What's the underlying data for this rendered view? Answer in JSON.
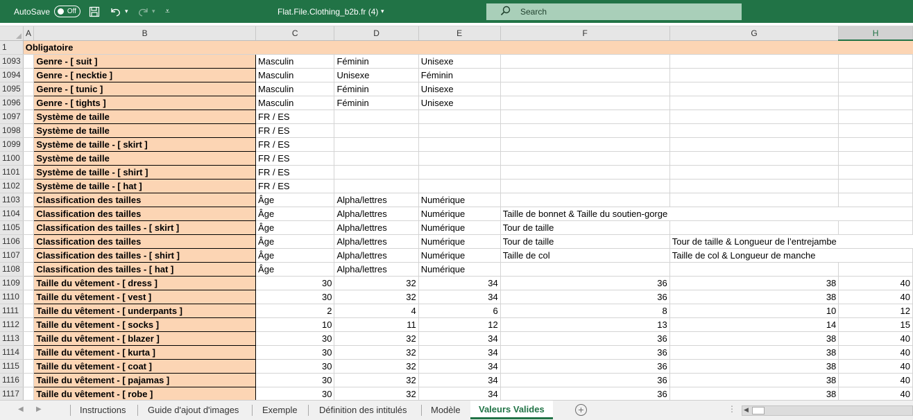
{
  "titlebar": {
    "autosave_label": "AutoSave",
    "autosave_state": "Off",
    "doc_title": "Flat.File.Clothing_b2b.fr (4)",
    "search_placeholder": "Search"
  },
  "colors": {
    "ribbon_green": "#217346",
    "header_fill": "#fcd5b4",
    "search_bg": "#a9cfb9"
  },
  "columns": [
    "A",
    "B",
    "C",
    "D",
    "E",
    "F",
    "G",
    "H"
  ],
  "selected_column": "H",
  "header_row": {
    "num": "1",
    "label": "Obligatoire"
  },
  "rows": [
    {
      "num": "1093",
      "label": "Genre - [ suit ]",
      "c": "Masculin",
      "d": "Féminin",
      "e": "Unisexe",
      "f": "",
      "g": "",
      "h": ""
    },
    {
      "num": "1094",
      "label": "Genre - [ necktie ]",
      "c": "Masculin",
      "d": "Unisexe",
      "e": "Féminin",
      "f": "",
      "g": "",
      "h": ""
    },
    {
      "num": "1095",
      "label": "Genre - [ tunic ]",
      "c": "Masculin",
      "d": "Féminin",
      "e": "Unisexe",
      "f": "",
      "g": "",
      "h": ""
    },
    {
      "num": "1096",
      "label": "Genre - [ tights ]",
      "c": "Masculin",
      "d": "Féminin",
      "e": "Unisexe",
      "f": "",
      "g": "",
      "h": ""
    },
    {
      "num": "1097",
      "label": "Système de taille",
      "c": "FR / ES",
      "d": "",
      "e": "",
      "f": "",
      "g": "",
      "h": ""
    },
    {
      "num": "1098",
      "label": "Système de taille",
      "c": "FR / ES",
      "d": "",
      "e": "",
      "f": "",
      "g": "",
      "h": ""
    },
    {
      "num": "1099",
      "label": "Système de taille - [ skirt ]",
      "c": "FR / ES",
      "d": "",
      "e": "",
      "f": "",
      "g": "",
      "h": ""
    },
    {
      "num": "1100",
      "label": "Système de taille",
      "c": "FR / ES",
      "d": "",
      "e": "",
      "f": "",
      "g": "",
      "h": ""
    },
    {
      "num": "1101",
      "label": "Système de taille - [ shirt ]",
      "c": "FR / ES",
      "d": "",
      "e": "",
      "f": "",
      "g": "",
      "h": ""
    },
    {
      "num": "1102",
      "label": "Système de taille - [ hat ]",
      "c": "FR / ES",
      "d": "",
      "e": "",
      "f": "",
      "g": "",
      "h": ""
    },
    {
      "num": "1103",
      "label": "Classification des tailles",
      "c": "Âge",
      "d": "Alpha/lettres",
      "e": "Numérique",
      "f": "",
      "g": "",
      "h": ""
    },
    {
      "num": "1104",
      "label": "Classification des tailles",
      "c": "Âge",
      "d": "Alpha/lettres",
      "e": "Numérique",
      "f": "Taille de bonnet & Taille du soutien-gorge",
      "g": "",
      "h": ""
    },
    {
      "num": "1105",
      "label": "Classification des tailles - [ skirt ]",
      "c": "Âge",
      "d": "Alpha/lettres",
      "e": "Numérique",
      "f": "Tour de taille",
      "g": "",
      "h": ""
    },
    {
      "num": "1106",
      "label": "Classification des tailles",
      "c": "Âge",
      "d": "Alpha/lettres",
      "e": "Numérique",
      "f": "Tour de taille",
      "g": "Tour de taille & Longueur de l’entrejambe",
      "h": ""
    },
    {
      "num": "1107",
      "label": "Classification des tailles - [ shirt ]",
      "c": "Âge",
      "d": "Alpha/lettres",
      "e": "Numérique",
      "f": "Taille de col",
      "g": "Taille de col & Longueur de manche",
      "h": ""
    },
    {
      "num": "1108",
      "label": "Classification des tailles - [ hat ]",
      "c": "Âge",
      "d": "Alpha/lettres",
      "e": "Numérique",
      "f": "",
      "g": "",
      "h": ""
    },
    {
      "num": "1109",
      "label": "Taille du vêtement - [ dress ]",
      "c": "30",
      "d": "32",
      "e": "34",
      "f": "36",
      "g": "38",
      "h": "40"
    },
    {
      "num": "1110",
      "label": "Taille du vêtement - [ vest ]",
      "c": "30",
      "d": "32",
      "e": "34",
      "f": "36",
      "g": "38",
      "h": "40"
    },
    {
      "num": "1111",
      "label": "Taille du vêtement - [ underpants ]",
      "c": "2",
      "d": "4",
      "e": "6",
      "f": "8",
      "g": "10",
      "h": "12"
    },
    {
      "num": "1112",
      "label": "Taille du vêtement - [ socks ]",
      "c": "10",
      "d": "11",
      "e": "12",
      "f": "13",
      "g": "14",
      "h": "15"
    },
    {
      "num": "1113",
      "label": "Taille du vêtement - [ blazer ]",
      "c": "30",
      "d": "32",
      "e": "34",
      "f": "36",
      "g": "38",
      "h": "40"
    },
    {
      "num": "1114",
      "label": "Taille du vêtement - [ kurta ]",
      "c": "30",
      "d": "32",
      "e": "34",
      "f": "36",
      "g": "38",
      "h": "40"
    },
    {
      "num": "1115",
      "label": "Taille du vêtement - [ coat ]",
      "c": "30",
      "d": "32",
      "e": "34",
      "f": "36",
      "g": "38",
      "h": "40"
    },
    {
      "num": "1116",
      "label": "Taille du vêtement - [ pajamas ]",
      "c": "30",
      "d": "32",
      "e": "34",
      "f": "36",
      "g": "38",
      "h": "40"
    },
    {
      "num": "1117",
      "label": "Taille du vêtement - [ robe ]",
      "c": "30",
      "d": "32",
      "e": "34",
      "f": "36",
      "g": "38",
      "h": "40"
    }
  ],
  "sheet_tabs": [
    "Instructions",
    "Guide d'ajout d'images",
    "Exemple",
    "Définition des intitulés",
    "Modèle",
    "Valeurs Valides"
  ],
  "active_tab": "Valeurs Valides",
  "icons": {
    "save": "save-icon",
    "undo": "undo-icon",
    "redo": "redo-icon",
    "search": "search-icon",
    "add_sheet": "plus-circle-icon"
  }
}
